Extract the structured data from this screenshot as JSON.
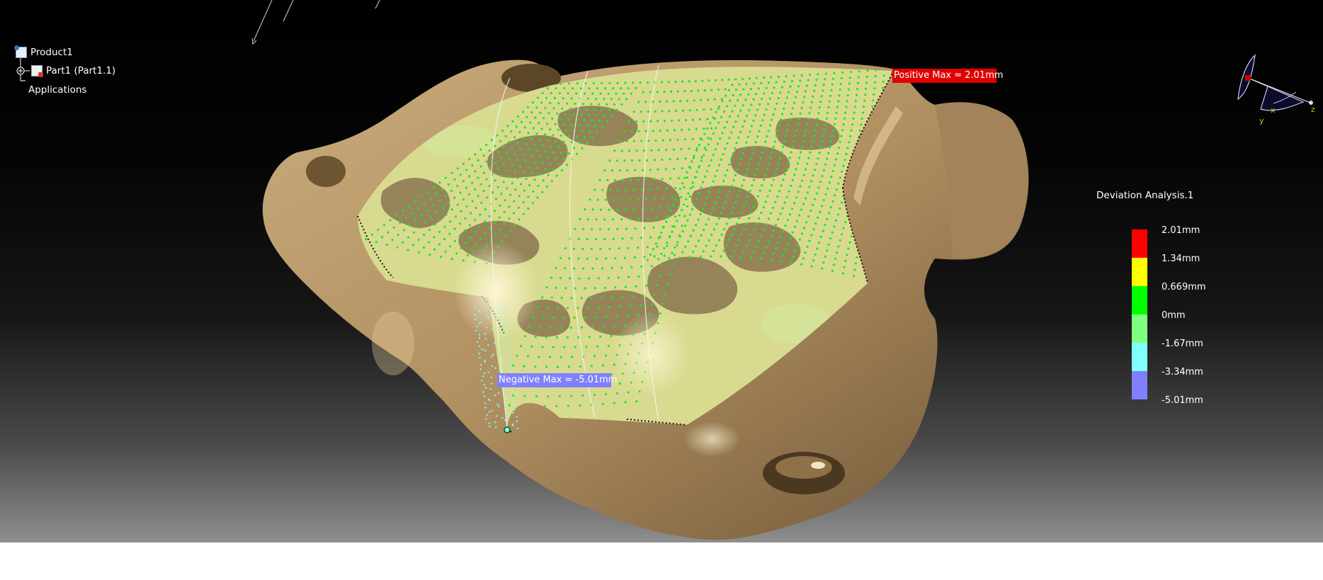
{
  "tree": {
    "items": [
      {
        "label": "Product1",
        "icon": "product-icon"
      },
      {
        "label": "Part1 (Part1.1)",
        "icon": "part-icon"
      },
      {
        "label": "Applications",
        "icon": ""
      }
    ]
  },
  "annotations": {
    "positive_max": "Positive Max = 2.01mm",
    "negative_max": "Negative Max = -5.01mm"
  },
  "legend": {
    "title": "Deviation Analysis.1",
    "entries": [
      {
        "label": "2.01mm",
        "color": "#ff0000"
      },
      {
        "label": "1.34mm",
        "color": "#ffff00"
      },
      {
        "label": "0.669mm",
        "color": "#00ff00"
      },
      {
        "label": "0mm",
        "color": "#80ff80"
      },
      {
        "label": "-1.67mm",
        "color": "#80ffff"
      },
      {
        "label": "-3.34mm",
        "color": "#8080ff"
      },
      {
        "label": "-5.01mm",
        "color": ""
      }
    ]
  },
  "compass": {
    "x_label": "x",
    "y_label": "y",
    "z_label": "z"
  },
  "colors": {
    "model": "#b49468",
    "deviation_points": "#22e622",
    "negative_points": "#80ffff"
  }
}
